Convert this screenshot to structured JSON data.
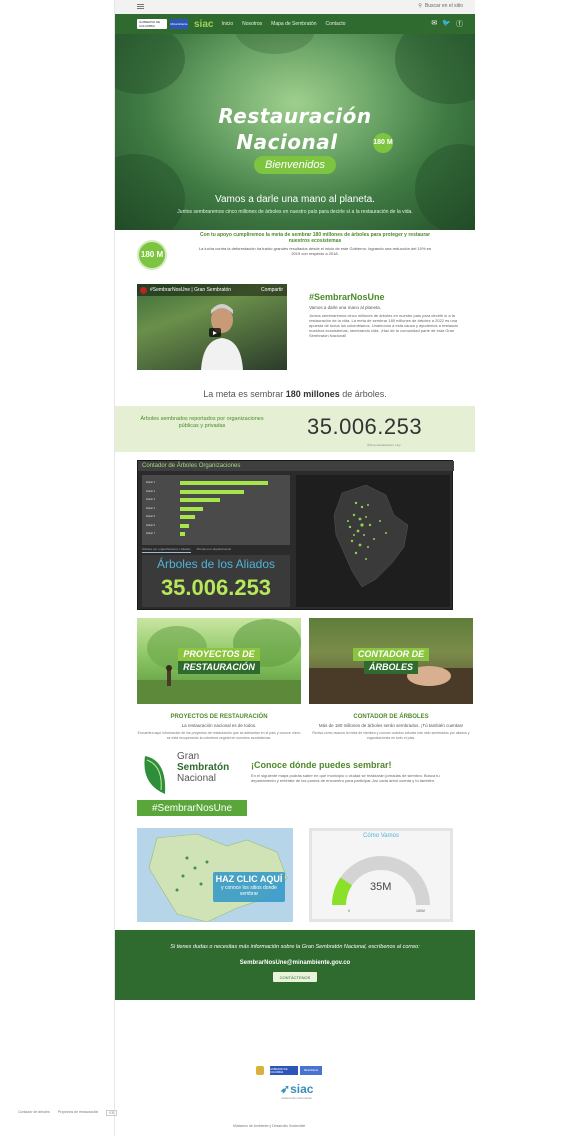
{
  "top_bar": {
    "search_placeholder": "Buscar en el sitio"
  },
  "nav": {
    "gov_label": "GOBIERNO DE COLOMBIA",
    "gov2_label": "Minambiente",
    "siac_logo": "siac",
    "links": [
      "Inicio",
      "Nosotros",
      "Mapa de Sembratón",
      "Contacto"
    ],
    "social_icons": [
      "mail-icon",
      "twitter-icon",
      "facebook-icon"
    ]
  },
  "hero": {
    "title_line1": "Restauración",
    "title_line2": "Nacional",
    "badge": "180 M",
    "welcome": "Bienvenidos",
    "subtitle": "Vamos a darle una mano al planeta.",
    "small": "Juntos sembraremos cinco millones de árboles en nuestro país para decirle sí a la restauración de la vida."
  },
  "intro": {
    "logo": "180 M",
    "headline": "Con tu apoyo cumpliremos la meta de sembrar 180 millones de árboles para proteger y restaurar nuestros ecosistemas",
    "body": "La lucha contra la deforestación ha traído grandes resultados desde el inicio de este Gobierno, logrando una reducción del 10% en 2019 con respecto a 2018."
  },
  "video": {
    "channel_title": "#SembrarNosUne | Gran Sembratón",
    "share_label": "Compartir",
    "title": "#SembrarNosUne",
    "subtitle": "Vamos a darle una mano al planeta.",
    "body": "Juntos sembraremos cinco millones de árboles en nuestro país para decirle sí a la restauración de la vida. La meta de sembrar 180 millones de árboles a 2022 es una apuesta de todos los colombianos. Unámonos a esta causa y ayudemos a restaurar nuestros ecosistemas, sembrando vida. ¡Haz de tu comunidad parte de esta Gran Sembratón Nacional!"
  },
  "meta": {
    "prefix": "La meta es sembrar ",
    "bold": "180 millones",
    "suffix": " de árboles."
  },
  "stats": {
    "label": "Árboles sembrados reportados por organizaciones públicas y privadas",
    "value": "35.006.253",
    "footnote": "Última actualización: Hoy"
  },
  "dashboard": {
    "header": "Contador de Árboles Organizaciones",
    "tabs": [
      "Árboles por organizaciones / Aliados",
      "Árboles por departamento"
    ],
    "big_title": "Árboles de los Aliados",
    "big_value": "35.006.253",
    "bars": [
      {
        "label": "Aliado 1",
        "value": 0.85
      },
      {
        "label": "Aliado 2",
        "value": 0.62
      },
      {
        "label": "Aliado 3",
        "value": 0.38
      },
      {
        "label": "Aliado 4",
        "value": 0.22
      },
      {
        "label": "Aliado 5",
        "value": 0.14
      },
      {
        "label": "Aliado 6",
        "value": 0.09
      },
      {
        "label": "Aliado 7",
        "value": 0.05
      }
    ]
  },
  "cards": [
    {
      "tag_line1": "PROYECTOS DE",
      "tag_line2": "RESTAURACIÓN",
      "title": "PROYECTOS DE RESTAURACIÓN",
      "subtitle": "La restauración nacional es de todos.",
      "body": "Encuentra aquí información de los proyectos de restauración que se adelantan en el país y conoce cómo se está recuperando la cobertura vegetal en nuestros ecosistemas."
    },
    {
      "tag_line1": "CONTADOR DE",
      "tag_line2": "ÁRBOLES",
      "title": "CONTADOR DE ÁRBOLES",
      "subtitle": "Más de 180 millones de árboles serán sembrados. ¡Tú también cuentas!",
      "body": "Revisa cómo avanza la meta de siembra y conoce cuántos árboles han sido sembrados por aliados y organizaciones en todo el país."
    }
  ],
  "gran_sembraton": {
    "logo_line1": "Gran",
    "logo_line2": "Sembratón",
    "logo_line3": "Nacional",
    "tag": "#SembrarNosUne",
    "title": "¡Conoce dónde puedes sembrar!",
    "body": "En el siguiente mapa podrás saber en qué municipio o ciudad se realizarán jornadas de siembra. Busca tu departamento y entérate de los puntos de encuentro para participar. Así cada árbol cuenta y tú también."
  },
  "map_cta": {
    "line1": "HAZ CLIC AQUÍ",
    "line2": "y conoce los sitios donde sembrar"
  },
  "gauge": {
    "title": "Cómo Vamos",
    "value": "35M",
    "min": "0",
    "max": "180M",
    "fraction": 0.19
  },
  "contact": {
    "text": "Si tienes dudas o necesitas más información sobre la Gran Sembratón Nacional, escríbenos al correo:",
    "email": "SembrarNosUne@minambiente.gov.co",
    "button": "CONTÁCTENOS"
  },
  "footer": {
    "logo_a": "GOBIERNO DE COLOMBIA",
    "logo_b": "Minambiente",
    "siac": "siac",
    "siac_sub": "sistema de información",
    "links": [
      "Contador de árboles",
      "Proyectos de restauración"
    ],
    "lang": "ES",
    "copyright": "Ministerio de Ambiente y Desarrollo Sostenible"
  }
}
